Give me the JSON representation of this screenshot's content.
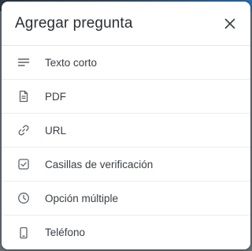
{
  "dialog": {
    "title": "Agregar pregunta",
    "close_icon": "close-icon"
  },
  "items": [
    {
      "label": "Texto corto",
      "icon": "short-text-icon"
    },
    {
      "label": "PDF",
      "icon": "document-icon"
    },
    {
      "label": "URL",
      "icon": "link-icon"
    },
    {
      "label": "Casillas de verificación",
      "icon": "checkbox-icon"
    },
    {
      "label": "Opción múltiple",
      "icon": "clock-icon"
    },
    {
      "label": "Teléfono",
      "icon": "phone-icon"
    }
  ],
  "colors": {
    "icon": "#5f6368",
    "text": "#3a3f45",
    "title": "#2b2f33"
  }
}
